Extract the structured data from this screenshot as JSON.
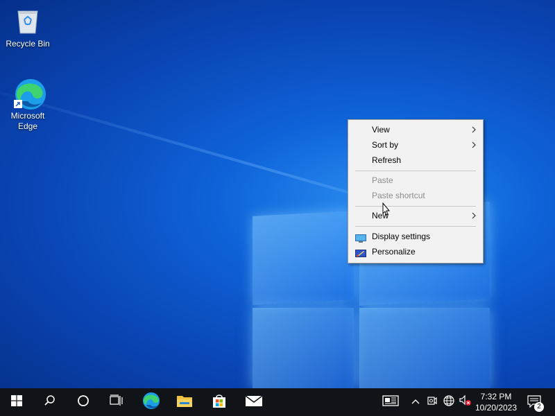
{
  "desktop": {
    "icons": [
      {
        "label": "Recycle Bin",
        "icon": "recycle-bin-icon"
      },
      {
        "label": "Microsoft Edge",
        "icon": "edge-icon"
      }
    ]
  },
  "context_menu": {
    "items": [
      {
        "label": "View",
        "submenu": true,
        "enabled": true
      },
      {
        "label": "Sort by",
        "submenu": true,
        "enabled": true
      },
      {
        "label": "Refresh",
        "submenu": false,
        "enabled": true
      },
      {
        "label": "Paste",
        "submenu": false,
        "enabled": false
      },
      {
        "label": "Paste shortcut",
        "submenu": false,
        "enabled": false
      },
      {
        "label": "New",
        "submenu": true,
        "enabled": true
      },
      {
        "label": "Display settings",
        "submenu": false,
        "enabled": true,
        "icon": "display-settings-icon"
      },
      {
        "label": "Personalize",
        "submenu": false,
        "enabled": true,
        "icon": "personalize-icon"
      }
    ]
  },
  "taskbar": {
    "pinned": [
      "start-icon",
      "search-icon",
      "cortana-icon",
      "task-view-icon",
      "edge-icon",
      "file-explorer-icon",
      "store-icon",
      "mail-icon"
    ],
    "tray": [
      "news-icon",
      "chevron-up-icon",
      "meet-now-icon",
      "network-icon",
      "volume-muted-icon"
    ],
    "clock": {
      "time": "7:32 PM",
      "date": "10/20/2023"
    },
    "notification_count": "2"
  },
  "colors": {
    "accent": "#0f63d8",
    "taskbar": "#101418",
    "menu_bg": "#f2f2f2",
    "disabled_text": "#8d8d8d"
  }
}
